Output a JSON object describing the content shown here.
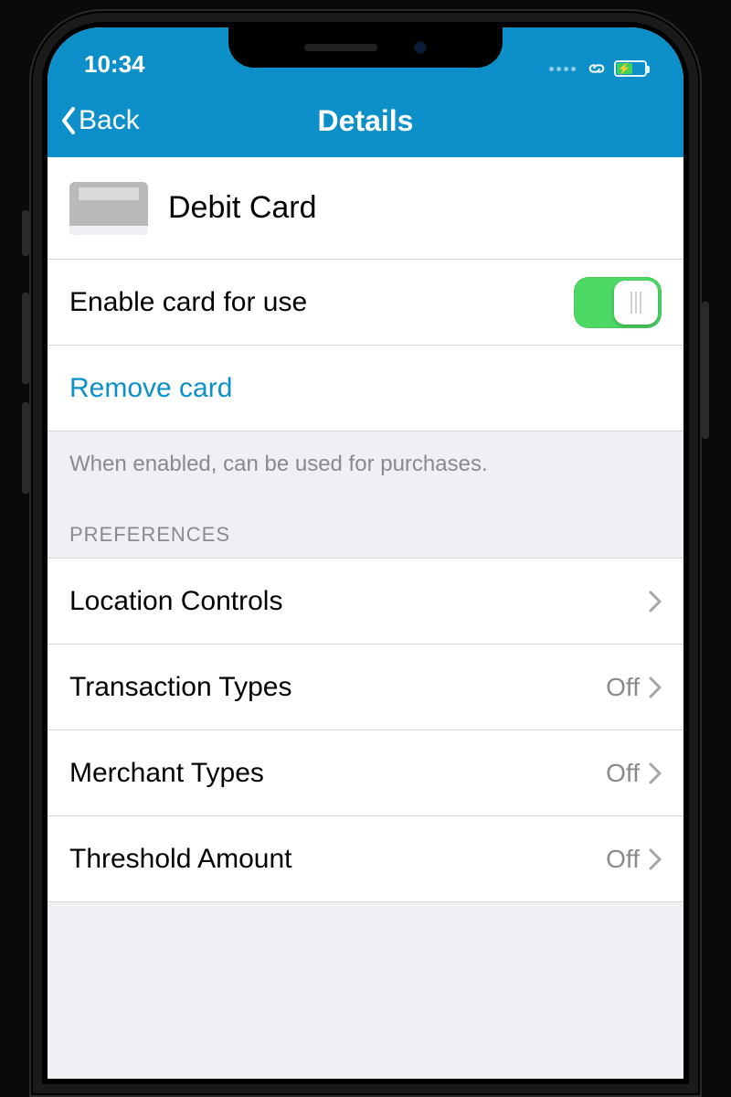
{
  "status": {
    "time": "10:34"
  },
  "nav": {
    "back_label": "Back",
    "title": "Details"
  },
  "card": {
    "name": "Debit Card"
  },
  "enable": {
    "label": "Enable card for use",
    "on": true
  },
  "remove": {
    "label": "Remove card"
  },
  "footer_note": "When enabled, can be used for purchases.",
  "preferences": {
    "header": "PREFERENCES",
    "items": [
      {
        "label": "Location Controls",
        "value": ""
      },
      {
        "label": "Transaction Types",
        "value": "Off"
      },
      {
        "label": "Merchant Types",
        "value": "Off"
      },
      {
        "label": "Threshold Amount",
        "value": "Off"
      }
    ]
  },
  "colors": {
    "accent": "#0d8fc9",
    "toggle_on": "#4cd964"
  }
}
